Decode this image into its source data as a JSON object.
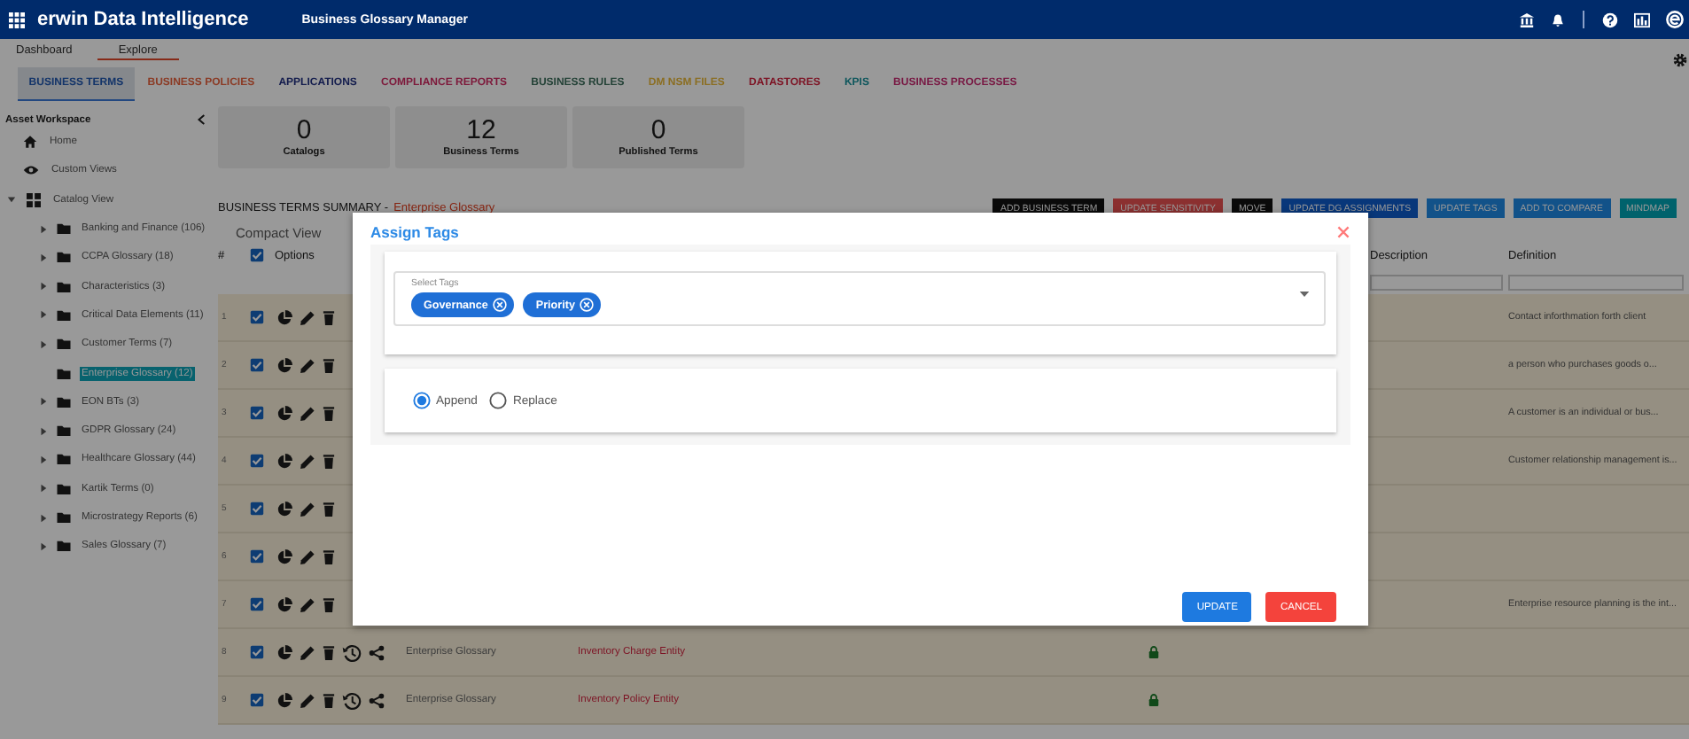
{
  "app": {
    "title": "erwin Data Intelligence",
    "module": "Business Glossary Manager"
  },
  "subnav": [
    {
      "label": "Dashboard",
      "selected": false
    },
    {
      "label": "Explore",
      "selected": true
    }
  ],
  "asset_tabs": [
    {
      "label": "BUSINESS TERMS",
      "selected": true,
      "color": "#133469"
    },
    {
      "label": "BUSINESS POLICIES",
      "selected": false,
      "color": "#8b3a24"
    },
    {
      "label": "APPLICATIONS",
      "selected": false,
      "color": "#131c4d"
    },
    {
      "label": "COMPLIANCE REPORTS",
      "selected": false,
      "color": "#7d183a"
    },
    {
      "label": "BUSINESS RULES",
      "selected": false,
      "color": "#244237"
    },
    {
      "label": "DM NSM FILES",
      "selected": false,
      "color": "#8b6e22"
    },
    {
      "label": "DATASTORES",
      "selected": false,
      "color": "#7d1324"
    },
    {
      "label": "KPIS",
      "selected": false,
      "color": "#0d565c"
    },
    {
      "label": "BUSINESS PROCESSES",
      "selected": false,
      "color": "#781843"
    }
  ],
  "sidebar": {
    "title": "Asset Workspace",
    "items": [
      {
        "label": "Home",
        "kind": "home"
      },
      {
        "label": "Custom Views",
        "kind": "views"
      },
      {
        "label": "Catalog View",
        "kind": "catalog",
        "expanded": true,
        "children": [
          {
            "label": "Banking and Finance (106)",
            "expandable": true,
            "selected": false
          },
          {
            "label": "CCPA Glossary (18)",
            "expandable": true,
            "selected": false
          },
          {
            "label": "Characteristics (3)",
            "expandable": true,
            "selected": false
          },
          {
            "label": "Critical Data Elements (11)",
            "expandable": true,
            "selected": false
          },
          {
            "label": "Customer Terms (7)",
            "expandable": true,
            "selected": false
          },
          {
            "label": "Enterprise Glossary (12)",
            "expandable": false,
            "selected": true
          },
          {
            "label": "EON BTs (3)",
            "expandable": true,
            "selected": false
          },
          {
            "label": "GDPR Glossary (24)",
            "expandable": true,
            "selected": false
          },
          {
            "label": "Healthcare Glossary (44)",
            "expandable": true,
            "selected": false
          },
          {
            "label": "Kartik Terms (0)",
            "expandable": true,
            "selected": false
          },
          {
            "label": "Microstrategy Reports (6)",
            "expandable": true,
            "selected": false
          },
          {
            "label": "Sales Glossary (7)",
            "expandable": true,
            "selected": false
          }
        ]
      }
    ]
  },
  "stats": [
    {
      "value": "0",
      "label": "Catalogs"
    },
    {
      "value": "12",
      "label": "Business Terms"
    },
    {
      "value": "0",
      "label": "Published Terms"
    }
  ],
  "summary": {
    "title": "BUSINESS TERMS SUMMARY -",
    "glossary": "Enterprise Glossary"
  },
  "actions": [
    {
      "label": "ADD BUSINESS TERM",
      "color": "#0a0a0a"
    },
    {
      "label": "UPDATE SENSITIVITY",
      "color": "#8b3030"
    },
    {
      "label": "MOVE",
      "color": "#0a0a0a"
    },
    {
      "label": "UPDATE DG ASSIGNMENTS",
      "color": "#08377a"
    },
    {
      "label": "UPDATE TAGS",
      "color": "#125289"
    },
    {
      "label": "ADD TO COMPARE",
      "color": "#125289"
    },
    {
      "label": "MINDMAP",
      "color": "#00626c"
    }
  ],
  "view_tabs": [
    {
      "label": "Compact View",
      "selected": false
    }
  ],
  "table": {
    "number_heading": "#",
    "select_all": true,
    "options_heading": "Options",
    "description_heading": "Description",
    "definition_heading": "Definition",
    "rows": [
      {
        "number": "1",
        "checked": true,
        "definition": "Contact inforthmation forth client"
      },
      {
        "number": "2",
        "checked": true,
        "definition": "a person who purchases goods o..."
      },
      {
        "number": "3",
        "checked": true,
        "definition": "A customer is an individual or bus..."
      },
      {
        "number": "4",
        "checked": true,
        "definition": "Customer relationship management is..."
      },
      {
        "number": "5",
        "checked": true
      },
      {
        "number": "6",
        "checked": true
      },
      {
        "number": "7",
        "checked": true,
        "definition": "Enterprise resource planning is the int..."
      },
      {
        "number": "8",
        "checked": true,
        "group": "Enterprise Glossary",
        "name": "Inventory Charge Entity",
        "locked": true
      },
      {
        "number": "9",
        "checked": true,
        "group": "Enterprise Glossary",
        "name": "Inventory Policy Entity",
        "locked": true
      }
    ]
  },
  "dialog": {
    "title": "Assign Tags",
    "tags_label": "Select Tags",
    "tags": [
      "Governance",
      "Priority"
    ],
    "modes": [
      {
        "label": "Append",
        "selected": true
      },
      {
        "label": "Replace",
        "selected": false
      }
    ],
    "buttons": [
      {
        "label": "UPDATE",
        "kind": "primary"
      },
      {
        "label": "CANCEL",
        "kind": "danger"
      }
    ]
  }
}
